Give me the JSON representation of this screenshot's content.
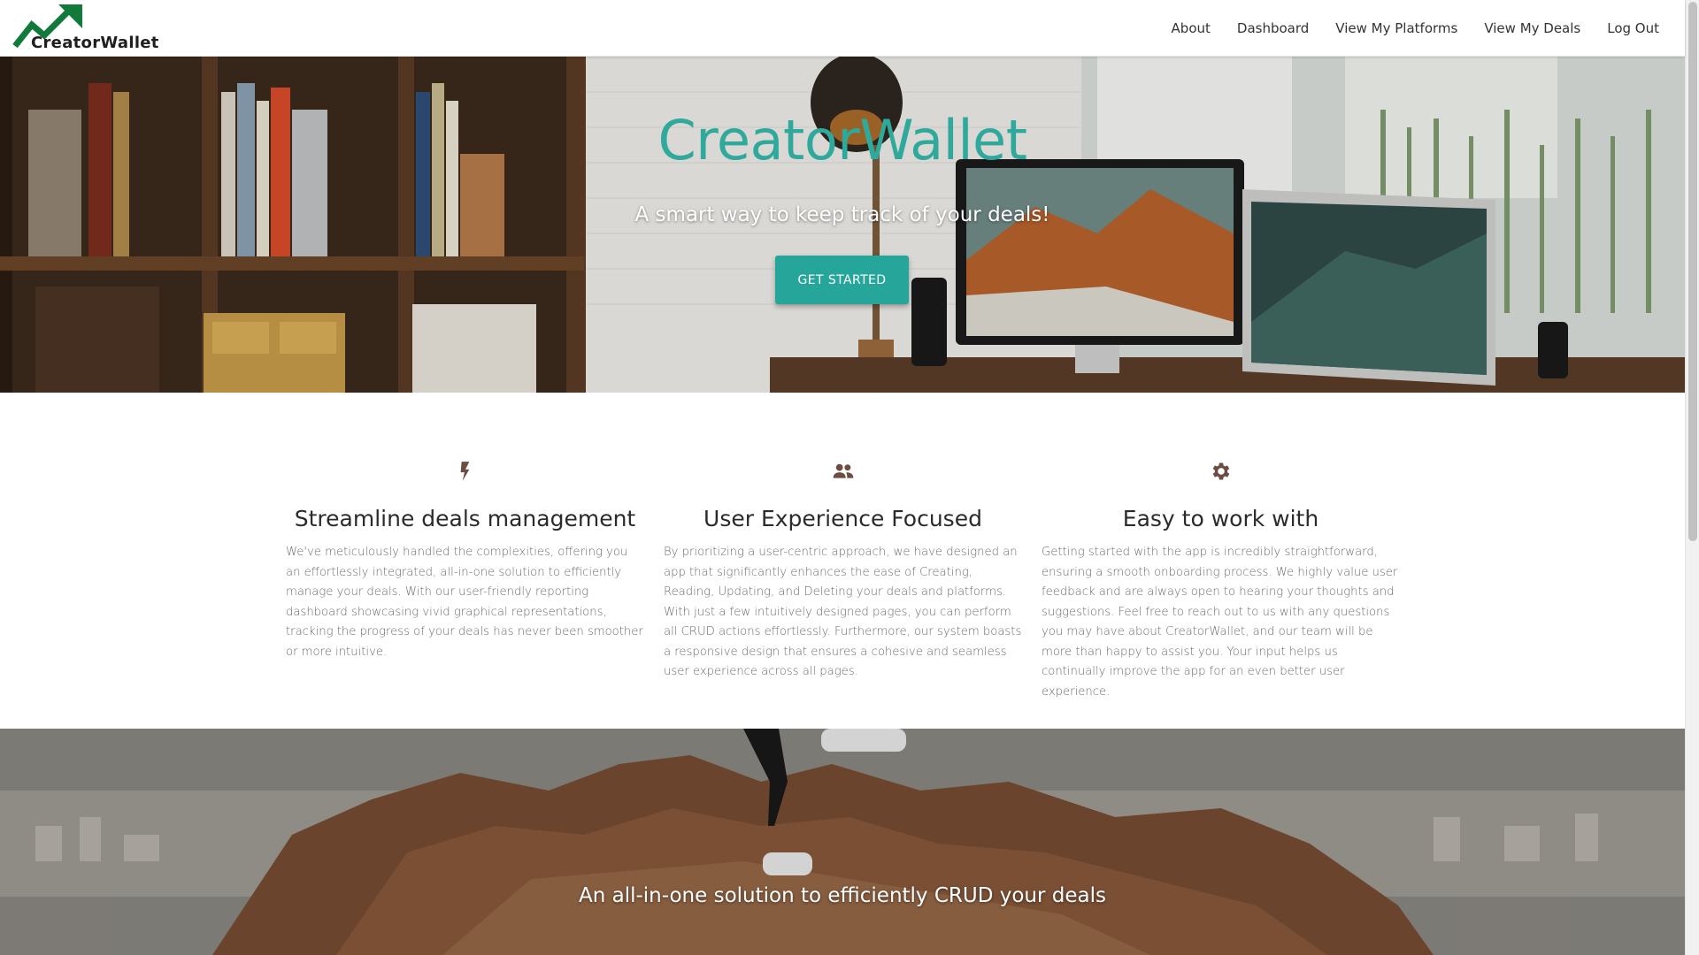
{
  "brand": {
    "name_part1": "Creator",
    "name_part2": "Wallet",
    "logo_icon": "trending-up-arrow-icon",
    "logo_color": "#117a3a"
  },
  "nav": {
    "links": [
      "About",
      "Dashboard",
      "View My Platforms",
      "View My Deals",
      "Log Out"
    ]
  },
  "hero": {
    "title": "CreatorWallet",
    "subtitle": "A smart way to keep track of your deals!",
    "button_label": "GET STARTED",
    "accent_color": "#26a69a"
  },
  "features": [
    {
      "icon": "flash-icon",
      "title": "Streamline deals management",
      "text": "We've meticulously handled the complexities, offering you an effortlessly integrated, all-in-one solution to efficiently manage your deals. With our user-friendly reporting dashboard showcasing vivid graphical representations, tracking the progress of your deals has never been smoother or more intuitive."
    },
    {
      "icon": "group-icon",
      "title": "User Experience Focused",
      "text": "By prioritizing a user-centric approach, we have designed an app that significantly enhances the ease of Creating, Reading, Updating, and Deleting your deals and platforms. With just a few intuitively designed pages, you can perform all CRUD actions effortlessly. Furthermore, our system boasts a responsive design that ensures a cohesive and seamless user experience across all pages."
    },
    {
      "icon": "settings-icon",
      "title": "Easy to work with",
      "text": "Getting started with the app is incredibly straightforward, ensuring a smooth onboarding process. We highly value user feedback and are always open to hearing your thoughts and suggestions. Feel free to reach out to us with any questions you may have about CreatorWallet, and our team will be more than happy to assist you. Your input helps us continually improve the app for an even better user experience."
    }
  ],
  "parallax": {
    "caption": "An all-in-one solution to efficiently CRUD your deals"
  }
}
